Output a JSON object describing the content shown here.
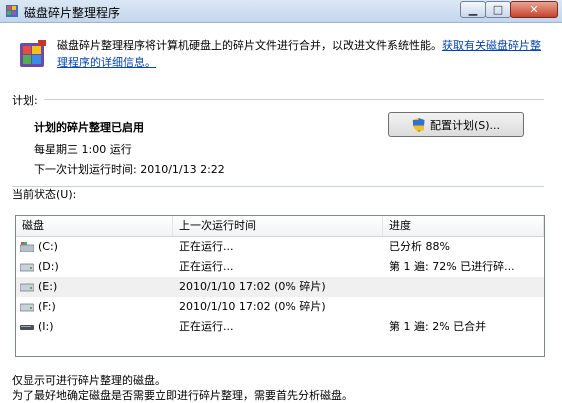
{
  "window": {
    "title": "磁盘碎片整理程序"
  },
  "intro": {
    "text": "磁盘碎片整理程序将计算机硬盘上的碎片文件进行合并，以改进文件系统性能。",
    "link": "获取有关磁盘碎片整理程序的详细信息。"
  },
  "schedule": {
    "section_label": "计划:",
    "status": "计划的碎片整理已启用",
    "frequency": "每星期三  1:00 运行",
    "next_run": "下一次计划运行时间: 2010/1/13 2:22",
    "config_button": "配置计划(S)..."
  },
  "current_status": {
    "label": "当前状态(U):",
    "columns": [
      "磁盘",
      "上一次运行时间",
      "进度"
    ],
    "rows": [
      {
        "disk": "(C:)",
        "last_run": "正在运行...",
        "progress": "已分析 88%",
        "icon": "system-drive-icon"
      },
      {
        "disk": "(D:)",
        "last_run": "正在运行...",
        "progress": "第 1 遍: 72% 已进行碎...",
        "icon": "drive-icon"
      },
      {
        "disk": "(E:)",
        "last_run": "2010/1/10 17:02 (0% 碎片)",
        "progress": "",
        "icon": "drive-icon"
      },
      {
        "disk": "(F:)",
        "last_run": "2010/1/10 17:02 (0% 碎片)",
        "progress": "",
        "icon": "drive-icon"
      },
      {
        "disk": "(I:)",
        "last_run": "正在运行...",
        "progress": "第 1 遍: 2% 已合并",
        "icon": "removable-drive-icon"
      }
    ]
  },
  "footer": {
    "line1": "仅显示可进行碎片整理的磁盘。",
    "line2": "为了最好地确定磁盘是否需要立即进行碎片整理，需要首先分析磁盘。"
  }
}
